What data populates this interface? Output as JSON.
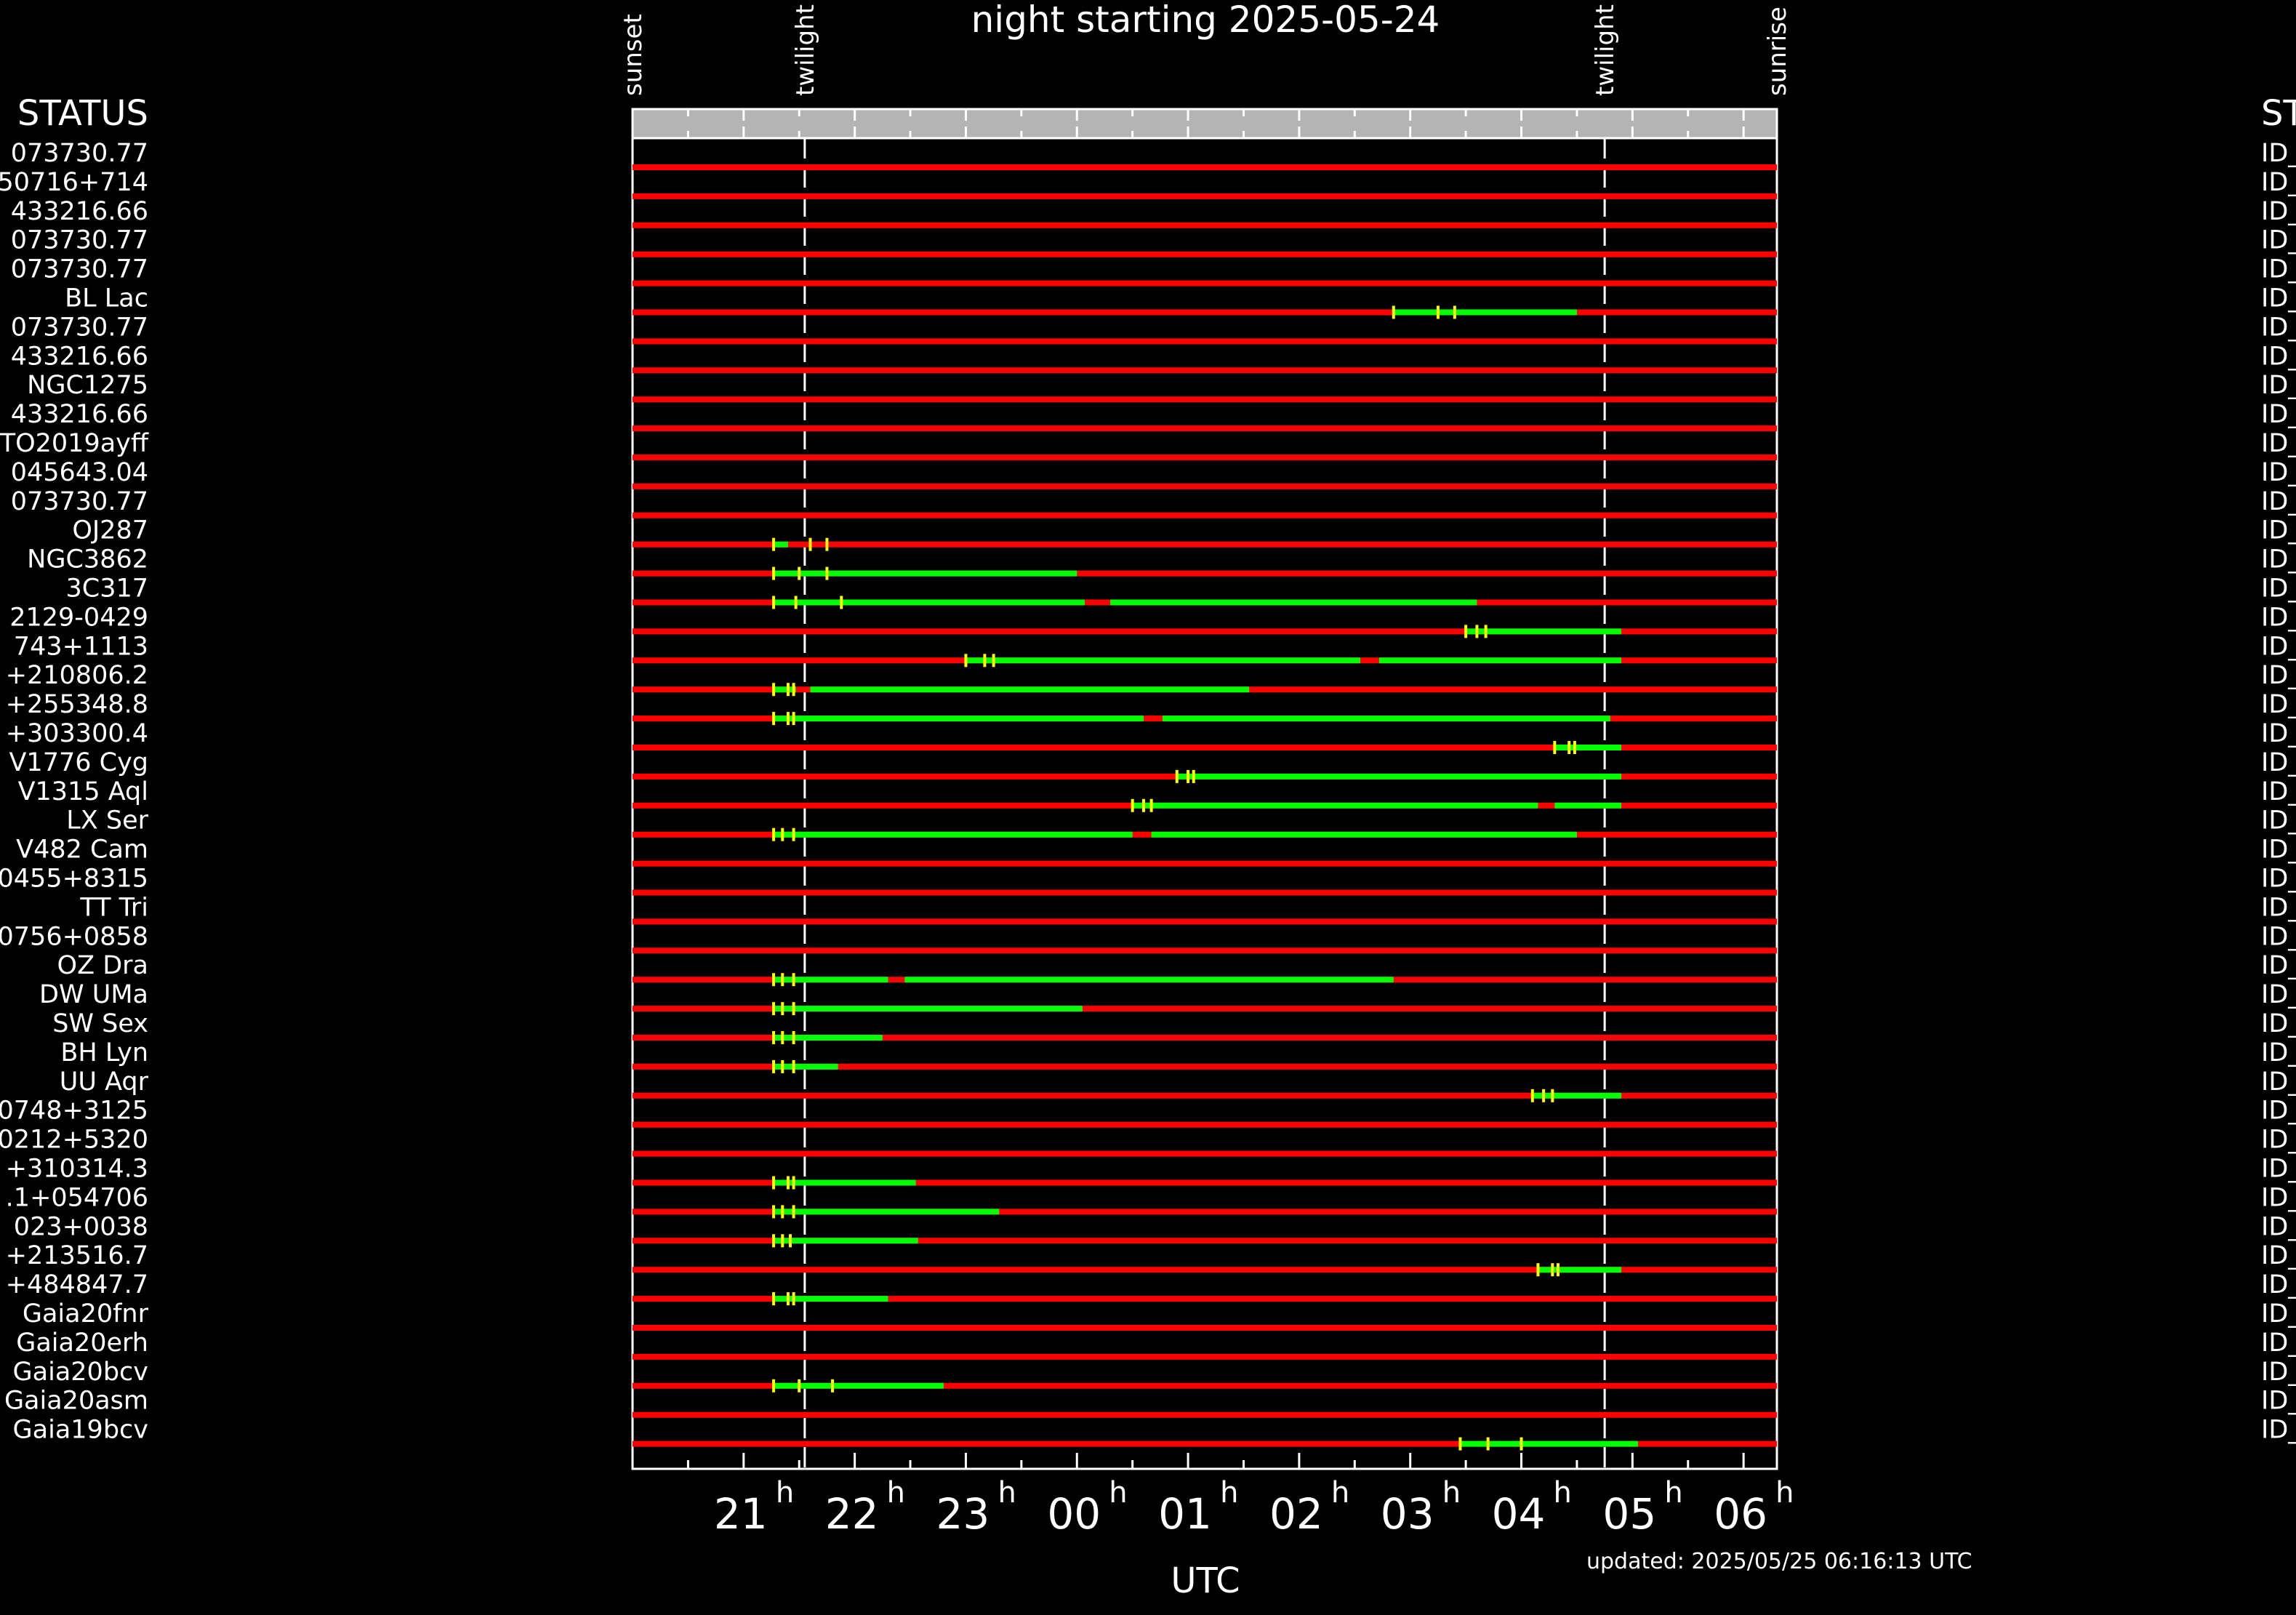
{
  "chart_data": {
    "type": "timeline",
    "title": "night starting 2025-05-24",
    "xlabel": "UTC",
    "updated": "updated: 2025/05/25 06:16:13 UTC",
    "left_header": "STATUS",
    "right_header": "ST",
    "right_label_prefix": "ID_",
    "x_range_hours": [
      20.0,
      30.3
    ],
    "x_ticks": [
      {
        "hour": 21,
        "label": "21",
        "sup": "h"
      },
      {
        "hour": 22,
        "label": "22",
        "sup": "h"
      },
      {
        "hour": 23,
        "label": "23",
        "sup": "h"
      },
      {
        "hour": 24,
        "label": "00",
        "sup": "h"
      },
      {
        "hour": 25,
        "label": "01",
        "sup": "h"
      },
      {
        "hour": 26,
        "label": "02",
        "sup": "h"
      },
      {
        "hour": 27,
        "label": "03",
        "sup": "h"
      },
      {
        "hour": 28,
        "label": "04",
        "sup": "h"
      },
      {
        "hour": 29,
        "label": "05",
        "sup": "h"
      },
      {
        "hour": 30,
        "label": "06",
        "sup": "h"
      }
    ],
    "night_markers": [
      {
        "label": "sunset",
        "hour": 20.0,
        "line": false
      },
      {
        "label": "twilight",
        "hour": 21.55,
        "line": true
      },
      {
        "label": "twilight",
        "hour": 28.75,
        "line": true
      },
      {
        "label": "sunrise",
        "hour": 30.3,
        "line": false
      }
    ],
    "colors": {
      "unavailable": "#ff0000",
      "observable": "#00ff00",
      "tick": "#ffff00",
      "header_bar": "#b4b4b4",
      "twilight": "#ffffff"
    },
    "rows": [
      {
        "name": "073730.77",
        "green": [],
        "ticks": []
      },
      {
        "name": "50716+714",
        "green": [],
        "ticks": []
      },
      {
        "name": "433216.66",
        "green": [],
        "ticks": []
      },
      {
        "name": "073730.77",
        "green": [],
        "ticks": []
      },
      {
        "name": "073730.77",
        "green": [],
        "ticks": []
      },
      {
        "name": "BL Lac",
        "green": [
          [
            26.85,
            28.5
          ]
        ],
        "ticks": [
          26.85,
          27.25,
          27.4
        ]
      },
      {
        "name": "073730.77",
        "green": [],
        "ticks": []
      },
      {
        "name": "433216.66",
        "green": [],
        "ticks": []
      },
      {
        "name": "NGC1275",
        "green": [],
        "ticks": []
      },
      {
        "name": "433216.66",
        "green": [],
        "ticks": []
      },
      {
        "name": "TO2019ayff",
        "green": [],
        "ticks": []
      },
      {
        "name": "045643.04",
        "green": [],
        "ticks": []
      },
      {
        "name": "073730.77",
        "green": [],
        "ticks": []
      },
      {
        "name": "OJ287",
        "green": [
          [
            21.27,
            21.4
          ]
        ],
        "ticks": [
          21.27,
          21.6,
          21.75
        ]
      },
      {
        "name": "NGC3862",
        "green": [
          [
            21.27,
            24.0
          ]
        ],
        "ticks": [
          21.27,
          21.5,
          21.75
        ]
      },
      {
        "name": "3C317",
        "green": [
          [
            21.27,
            24.07
          ],
          [
            24.3,
            27.6
          ]
        ],
        "ticks": [
          21.27,
          21.47,
          21.88
        ]
      },
      {
        "name": "2129-0429",
        "green": [
          [
            27.5,
            28.9
          ]
        ],
        "ticks": [
          27.5,
          27.6,
          27.68
        ]
      },
      {
        "name": "743+1113",
        "green": [
          [
            23.0,
            26.55
          ],
          [
            26.72,
            28.9
          ]
        ],
        "ticks": [
          23.0,
          23.17,
          23.25
        ]
      },
      {
        "name": "+210806.2",
        "green": [
          [
            21.27,
            21.47
          ],
          [
            21.6,
            25.55
          ]
        ],
        "ticks": [
          21.27,
          21.4,
          21.45
        ]
      },
      {
        "name": "+255348.8",
        "green": [
          [
            21.27,
            24.6
          ],
          [
            24.77,
            28.8
          ]
        ],
        "ticks": [
          21.27,
          21.4,
          21.45
        ]
      },
      {
        "name": "+303300.4",
        "green": [
          [
            28.3,
            28.9
          ]
        ],
        "ticks": [
          28.3,
          28.43,
          28.48
        ]
      },
      {
        "name": "V1776 Cyg",
        "green": [
          [
            24.9,
            28.9
          ]
        ],
        "ticks": [
          24.9,
          25.0,
          25.05
        ]
      },
      {
        "name": "V1315 Aql",
        "green": [
          [
            24.5,
            28.15
          ],
          [
            28.3,
            28.9
          ]
        ],
        "ticks": [
          24.5,
          24.6,
          24.67
        ]
      },
      {
        "name": "LX Ser",
        "green": [
          [
            21.27,
            24.5
          ],
          [
            24.67,
            28.5
          ]
        ],
        "ticks": [
          21.27,
          21.35,
          21.45
        ]
      },
      {
        "name": "V482 Cam",
        "green": [],
        "ticks": []
      },
      {
        "name": "0455+8315",
        "green": [],
        "ticks": []
      },
      {
        "name": "TT Tri",
        "green": [],
        "ticks": []
      },
      {
        "name": "0756+0858",
        "green": [],
        "ticks": []
      },
      {
        "name": "OZ Dra",
        "green": [
          [
            21.27,
            22.3
          ],
          [
            22.45,
            26.85
          ]
        ],
        "ticks": [
          21.27,
          21.35,
          21.45
        ]
      },
      {
        "name": "DW UMa",
        "green": [
          [
            21.27,
            24.05
          ]
        ],
        "ticks": [
          21.27,
          21.35,
          21.45
        ]
      },
      {
        "name": "SW Sex",
        "green": [
          [
            21.27,
            22.25
          ]
        ],
        "ticks": [
          21.27,
          21.35,
          21.45
        ]
      },
      {
        "name": "BH Lyn",
        "green": [
          [
            21.27,
            21.85
          ]
        ],
        "ticks": [
          21.27,
          21.35,
          21.45
        ]
      },
      {
        "name": "UU Aqr",
        "green": [
          [
            28.1,
            28.9
          ]
        ],
        "ticks": [
          28.1,
          28.2,
          28.28
        ]
      },
      {
        "name": "0748+3125",
        "green": [],
        "ticks": []
      },
      {
        "name": "0212+5320",
        "green": [],
        "ticks": []
      },
      {
        "name": "+310314.3",
        "green": [
          [
            21.27,
            22.55
          ]
        ],
        "ticks": [
          21.27,
          21.4,
          21.45
        ]
      },
      {
        "name": ".1+054706",
        "green": [
          [
            21.27,
            23.3
          ]
        ],
        "ticks": [
          21.27,
          21.35,
          21.45
        ]
      },
      {
        "name": "023+0038",
        "green": [
          [
            21.27,
            22.57
          ]
        ],
        "ticks": [
          21.27,
          21.35,
          21.42
        ]
      },
      {
        "name": "+213516.7",
        "green": [
          [
            28.15,
            28.9
          ]
        ],
        "ticks": [
          28.15,
          28.28,
          28.33
        ]
      },
      {
        "name": "+484847.7",
        "green": [
          [
            21.27,
            22.3
          ]
        ],
        "ticks": [
          21.27,
          21.4,
          21.45
        ]
      },
      {
        "name": "Gaia20fnr",
        "green": [],
        "ticks": []
      },
      {
        "name": "Gaia20erh",
        "green": [],
        "ticks": []
      },
      {
        "name": "Gaia20bcv",
        "green": [
          [
            21.27,
            22.8
          ]
        ],
        "ticks": [
          21.27,
          21.5,
          21.8
        ]
      },
      {
        "name": "Gaia20asm",
        "green": [],
        "ticks": []
      },
      {
        "name": "Gaia19bcv",
        "green": [
          [
            27.45,
            29.05
          ]
        ],
        "ticks": [
          27.45,
          27.7,
          28.0
        ]
      }
    ]
  }
}
